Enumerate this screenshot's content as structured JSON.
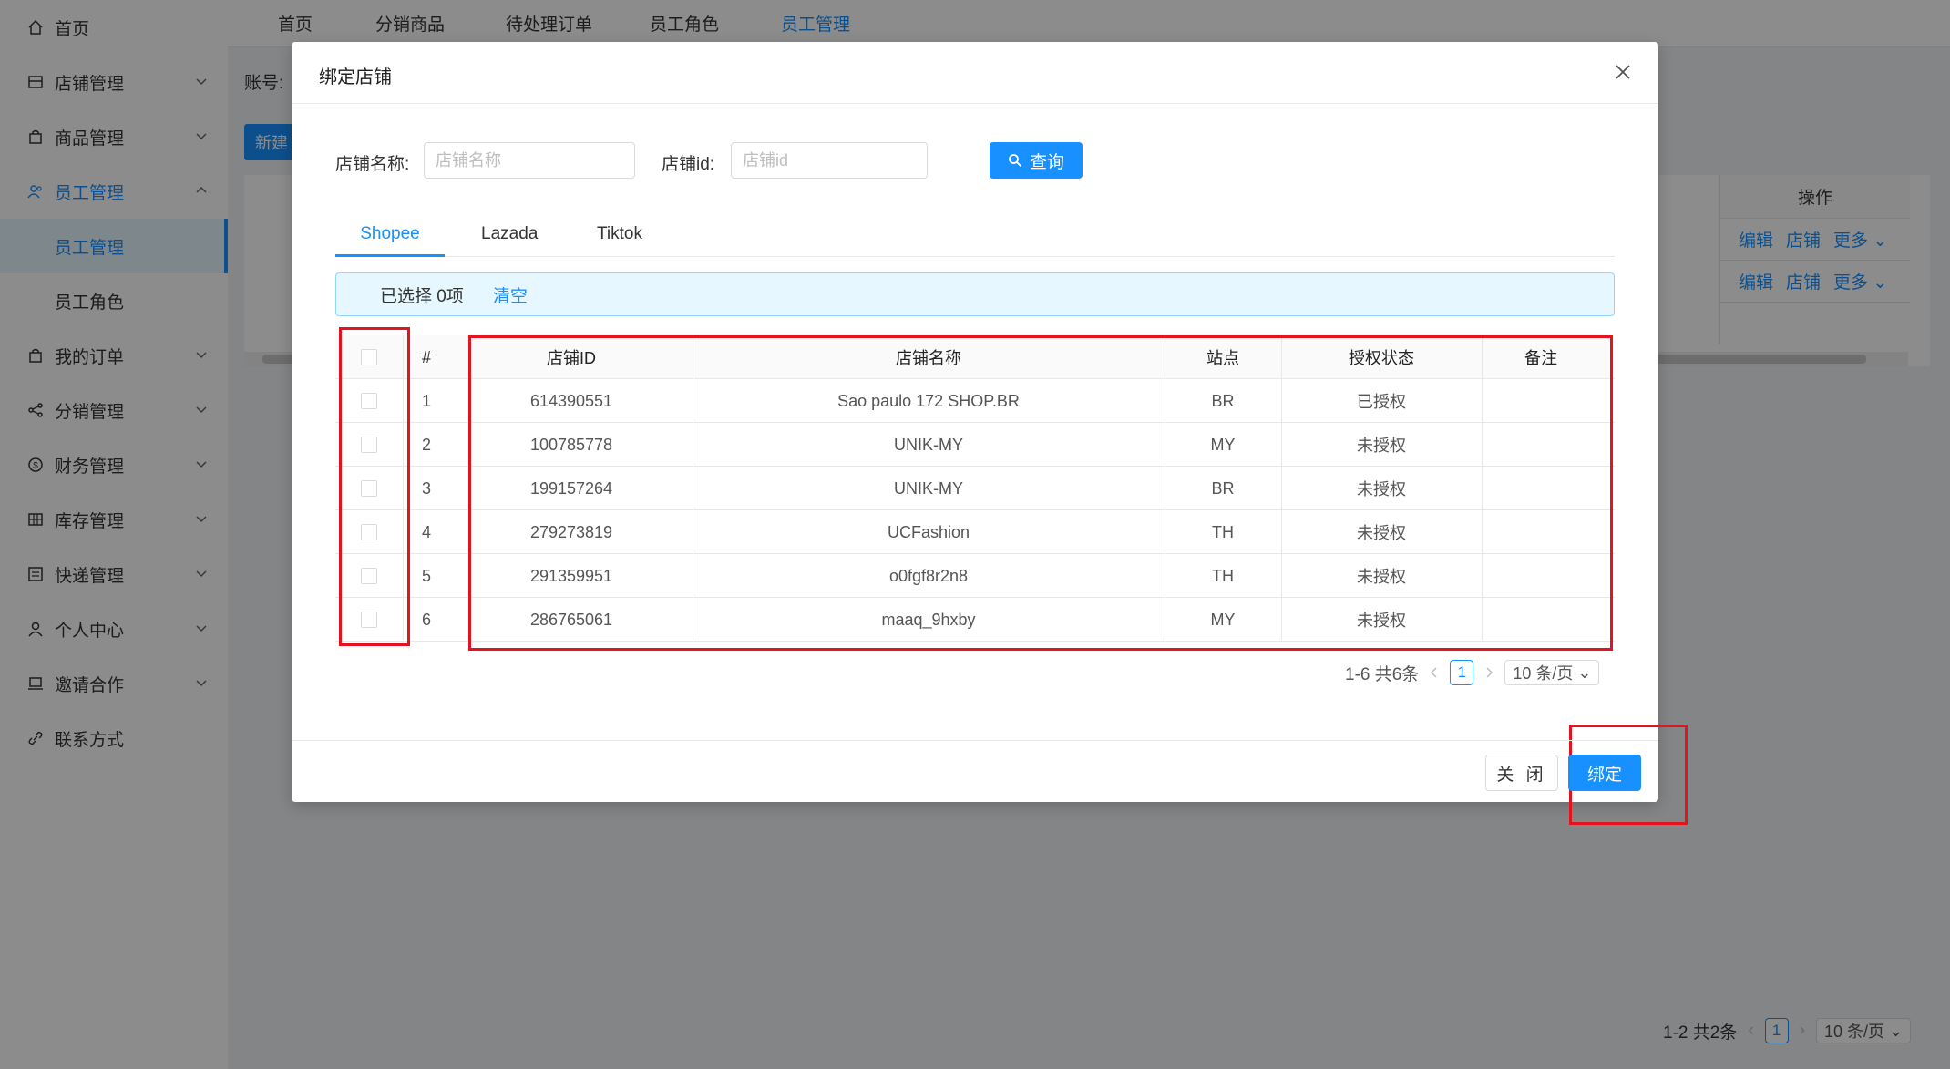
{
  "sidebar": {
    "items": [
      {
        "label": "首页",
        "icon": "home-icon"
      },
      {
        "label": "店铺管理",
        "icon": "store-icon"
      },
      {
        "label": "商品管理",
        "icon": "bag-icon"
      },
      {
        "label": "员工管理",
        "icon": "team-icon"
      },
      {
        "label": "员工管理",
        "icon": ""
      },
      {
        "label": "员工角色",
        "icon": ""
      },
      {
        "label": "我的订单",
        "icon": "bag-icon"
      },
      {
        "label": "分销管理",
        "icon": "share-icon"
      },
      {
        "label": "财务管理",
        "icon": "dollar-icon"
      },
      {
        "label": "库存管理",
        "icon": "grid-icon"
      },
      {
        "label": "快递管理",
        "icon": "list-icon"
      },
      {
        "label": "个人中心",
        "icon": "user-icon"
      },
      {
        "label": "邀请合作",
        "icon": "laptop-icon"
      },
      {
        "label": "联系方式",
        "icon": "link-icon"
      }
    ]
  },
  "topnav": {
    "tabs": [
      "首页",
      "分销商品",
      "待处理订单",
      "员工角色",
      "员工管理"
    ]
  },
  "background": {
    "account_label": "账号:",
    "new_button": "新建",
    "ops_header": "操作",
    "ops": [
      "编辑",
      "店铺",
      "更多"
    ],
    "pager_total": "1-2 共2条",
    "pager_page": "1",
    "pager_size": "10 条/页"
  },
  "modal": {
    "title": "绑定店铺",
    "search": {
      "shop_name_label": "店铺名称:",
      "shop_name_placeholder": "店铺名称",
      "shop_id_label": "店铺id:",
      "shop_id_placeholder": "店铺id",
      "query_button": "查询"
    },
    "tabs": [
      "Shopee",
      "Lazada",
      "Tiktok"
    ],
    "selection": {
      "text": "已选择 0项",
      "clear": "清空"
    },
    "table": {
      "headers": [
        "#",
        "店铺ID",
        "店铺名称",
        "站点",
        "授权状态",
        "备注"
      ],
      "rows": [
        {
          "index": "1",
          "shop_id": "614390551",
          "shop_name": "Sao paulo 172 SHOP.BR",
          "site": "BR",
          "status": "已授权",
          "remark": ""
        },
        {
          "index": "2",
          "shop_id": "100785778",
          "shop_name": "UNIK-MY",
          "site": "MY",
          "status": "未授权",
          "remark": ""
        },
        {
          "index": "3",
          "shop_id": "199157264",
          "shop_name": "UNIK-MY",
          "site": "BR",
          "status": "未授权",
          "remark": ""
        },
        {
          "index": "4",
          "shop_id": "279273819",
          "shop_name": "UCFashion",
          "site": "TH",
          "status": "未授权",
          "remark": ""
        },
        {
          "index": "5",
          "shop_id": "291359951",
          "shop_name": "o0fgf8r2n8",
          "site": "TH",
          "status": "未授权",
          "remark": ""
        },
        {
          "index": "6",
          "shop_id": "286765061",
          "shop_name": "maaq_9hxby",
          "site": "MY",
          "status": "未授权",
          "remark": ""
        }
      ]
    },
    "pager": {
      "total": "1-6 共6条",
      "page": "1",
      "size": "10 条/页"
    },
    "footer": {
      "close_button": "关 闭",
      "bind_button": "绑定"
    }
  },
  "colors": {
    "primary": "#1890ff",
    "highlight_box": "#e3141d",
    "mask": "rgba(0,0,0,0.45)"
  }
}
